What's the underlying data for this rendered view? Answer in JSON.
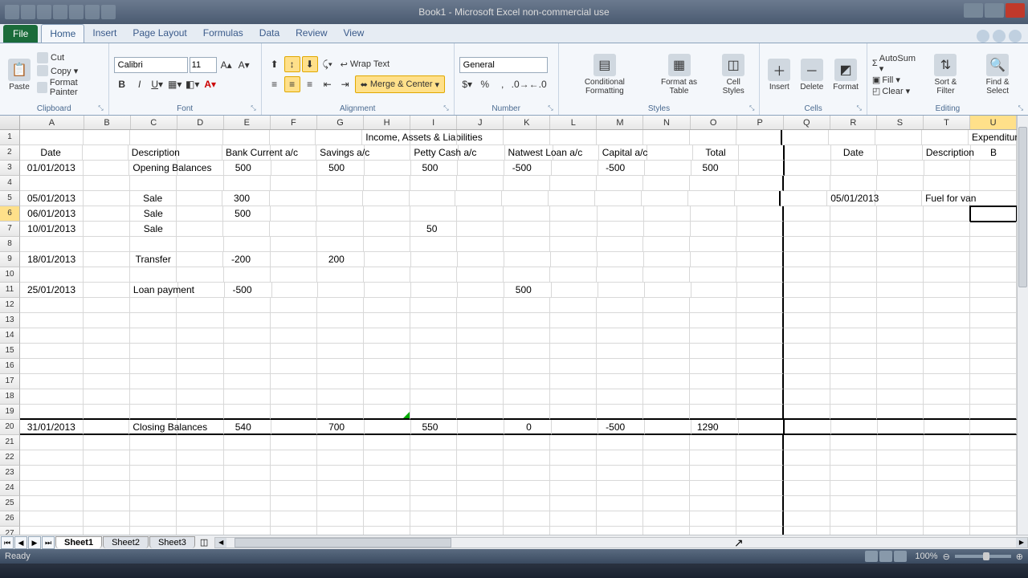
{
  "window": {
    "title": "Book1 - Microsoft Excel non-commercial use"
  },
  "tabs": {
    "file": "File",
    "items": [
      "Home",
      "Insert",
      "Page Layout",
      "Formulas",
      "Data",
      "Review",
      "View"
    ],
    "active": 0
  },
  "ribbon": {
    "clipboard": {
      "label": "Clipboard",
      "paste": "Paste",
      "cut": "Cut",
      "copy": "Copy ▾",
      "painter": "Format Painter"
    },
    "font": {
      "label": "Font",
      "name": "Calibri",
      "size": "11"
    },
    "alignment": {
      "label": "Alignment",
      "wrap": "Wrap Text",
      "merge": "Merge & Center"
    },
    "number": {
      "label": "Number",
      "format": "General"
    },
    "styles": {
      "label": "Styles",
      "cond": "Conditional Formatting",
      "table": "Format as Table",
      "cell": "Cell Styles"
    },
    "cells": {
      "label": "Cells",
      "insert": "Insert",
      "delete": "Delete",
      "format": "Format"
    },
    "editing": {
      "label": "Editing",
      "autosum": "AutoSum ▾",
      "fill": "Fill ▾",
      "clear": "Clear ▾",
      "sort": "Sort & Filter",
      "find": "Find & Select"
    }
  },
  "columns": [
    {
      "l": "A",
      "w": 82
    },
    {
      "l": "B",
      "w": 60
    },
    {
      "l": "C",
      "w": 60
    },
    {
      "l": "D",
      "w": 60
    },
    {
      "l": "E",
      "w": 60
    },
    {
      "l": "F",
      "w": 60
    },
    {
      "l": "G",
      "w": 60
    },
    {
      "l": "H",
      "w": 60
    },
    {
      "l": "I",
      "w": 60
    },
    {
      "l": "J",
      "w": 60
    },
    {
      "l": "K",
      "w": 60
    },
    {
      "l": "L",
      "w": 60
    },
    {
      "l": "M",
      "w": 60
    },
    {
      "l": "N",
      "w": 60
    },
    {
      "l": "O",
      "w": 60
    },
    {
      "l": "P",
      "w": 60
    },
    {
      "l": "Q",
      "w": 60
    },
    {
      "l": "R",
      "w": 60
    },
    {
      "l": "S",
      "w": 60
    },
    {
      "l": "T",
      "w": 60
    },
    {
      "l": "U",
      "w": 60
    }
  ],
  "selected": {
    "row": 6,
    "col": "U"
  },
  "headings": {
    "left_title": "Income, Assets & Liabilities",
    "right_title": "Expenditure"
  },
  "headers_row2": {
    "A": "Date",
    "C": "Description",
    "E": "Bank Current a/c",
    "G": "Savings a/c",
    "I": "Petty Cash a/c",
    "K": "Natwest Loan a/c",
    "M": "Capital a/c",
    "O": "Total",
    "R": "Date",
    "T": "Description",
    "U": "B"
  },
  "rows_data": {
    "3": {
      "A": "01/01/2013",
      "C": "Opening Balances",
      "E": "500",
      "G": "500",
      "I": "500",
      "K": "-500",
      "M": "-500",
      "O": "500"
    },
    "5": {
      "A": "05/01/2013",
      "C": "Sale",
      "E": "300",
      "R": "05/01/2013",
      "T": "Fuel for van"
    },
    "6": {
      "A": "06/01/2013",
      "C": "Sale",
      "E": "500"
    },
    "7": {
      "A": "10/01/2013",
      "C": "Sale",
      "I": "50"
    },
    "9": {
      "A": "18/01/2013",
      "C": "Transfer",
      "E": "-200",
      "G": "200"
    },
    "11": {
      "A": "25/01/2013",
      "C": "Loan payment",
      "E": "-500",
      "K": "500"
    },
    "20": {
      "A": "31/01/2013",
      "C": "Closing Balances",
      "E": "540",
      "G": "700",
      "I": "550",
      "K": "0",
      "M": "-500",
      "O": "1290"
    }
  },
  "sheets": [
    "Sheet1",
    "Sheet2",
    "Sheet3"
  ],
  "status": {
    "ready": "Ready",
    "zoom": "100%"
  },
  "chart_data": {
    "type": "table",
    "title": "Income, Assets & Liabilities",
    "columns": [
      "Date",
      "Description",
      "Bank Current a/c",
      "Savings a/c",
      "Petty Cash a/c",
      "Natwest Loan a/c",
      "Capital a/c",
      "Total"
    ],
    "rows": [
      [
        "01/01/2013",
        "Opening Balances",
        500,
        500,
        500,
        -500,
        -500,
        500
      ],
      [
        "05/01/2013",
        "Sale",
        300,
        null,
        null,
        null,
        null,
        null
      ],
      [
        "06/01/2013",
        "Sale",
        500,
        null,
        null,
        null,
        null,
        null
      ],
      [
        "10/01/2013",
        "Sale",
        null,
        null,
        50,
        null,
        null,
        null
      ],
      [
        "18/01/2013",
        "Transfer",
        -200,
        200,
        null,
        null,
        null,
        null
      ],
      [
        "25/01/2013",
        "Loan payment",
        -500,
        null,
        null,
        500,
        null,
        null
      ],
      [
        "31/01/2013",
        "Closing Balances",
        540,
        700,
        550,
        0,
        -500,
        1290
      ]
    ],
    "secondary": {
      "title": "Expenditure",
      "columns": [
        "Date",
        "Description"
      ],
      "rows": [
        [
          "05/01/2013",
          "Fuel for van"
        ]
      ]
    }
  }
}
